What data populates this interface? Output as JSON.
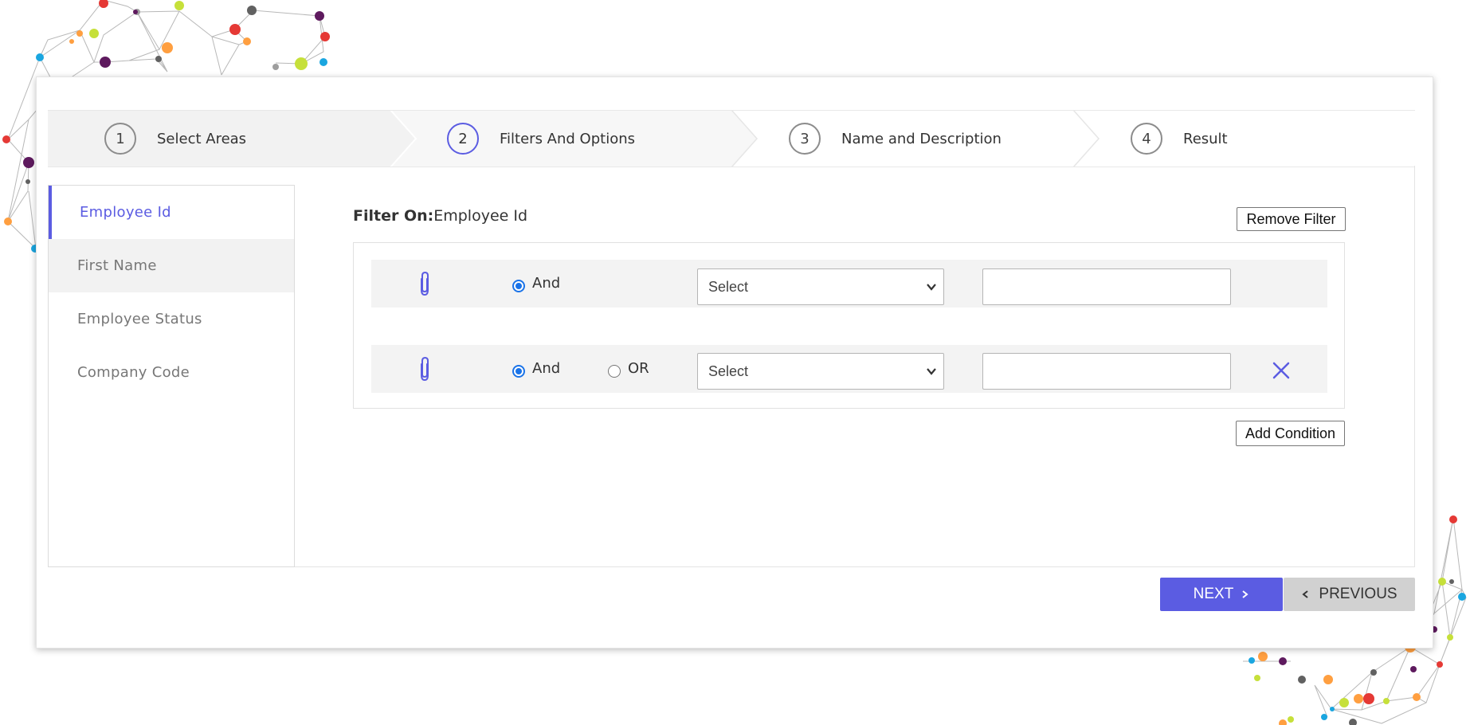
{
  "colors": {
    "accent": "#5b5ce2",
    "radio_checked": "#1a73e8",
    "row_bg": "#f3f3f3",
    "previous_bg": "#d1d1d1"
  },
  "stepper": {
    "steps": [
      {
        "number": "1",
        "label": "Select Areas",
        "state": "completed"
      },
      {
        "number": "2",
        "label": "Filters And Options",
        "state": "active"
      },
      {
        "number": "3",
        "label": "Name and Description",
        "state": "pending"
      },
      {
        "number": "4",
        "label": "Result",
        "state": "pending"
      }
    ]
  },
  "sidebar": {
    "items": [
      {
        "label": "Employee Id",
        "state": "selected"
      },
      {
        "label": "First Name",
        "state": "hover"
      },
      {
        "label": "Employee Status",
        "state": "normal"
      },
      {
        "label": "Company Code",
        "state": "normal"
      }
    ]
  },
  "filter": {
    "title_prefix": "Filter On:",
    "title_value": "Employee Id",
    "remove_label": "Remove Filter",
    "add_condition_label": "Add Condition",
    "conditions": [
      {
        "icon": "paperclip-icon",
        "and_label": "And",
        "and_checked": true,
        "operator_value": "Select",
        "value": ""
      },
      {
        "icon": "paperclip-icon",
        "and_label": "And",
        "and_checked": true,
        "or_label": "OR",
        "or_checked": false,
        "operator_value": "Select",
        "value": "",
        "remove_icon": "close-icon"
      }
    ]
  },
  "footer": {
    "next_label": "NEXT",
    "previous_label": "PREVIOUS"
  }
}
